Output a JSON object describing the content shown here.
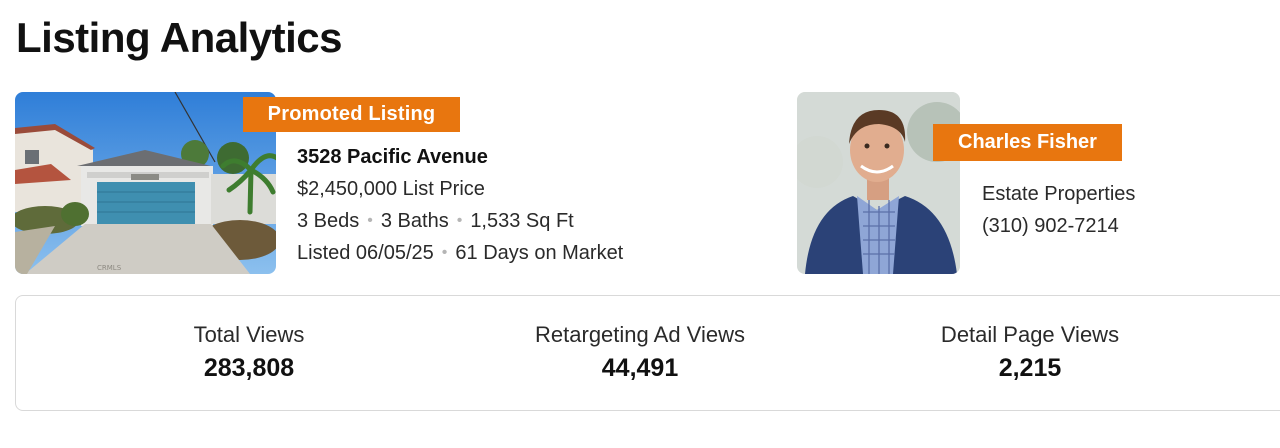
{
  "page": {
    "title": "Listing Analytics"
  },
  "listing": {
    "badge": "Promoted Listing",
    "address": "3528 Pacific Avenue",
    "price": "$2,450,000 List Price",
    "beds": "3 Beds",
    "baths": "3 Baths",
    "sqft": "1,533 Sq Ft",
    "listed": "Listed 06/05/25",
    "days_on_market": "61 Days on Market",
    "separator": "•",
    "photo_watermark": "CRMLS"
  },
  "agent": {
    "name": "Charles Fisher",
    "company": "Estate Properties",
    "phone": "(310) 902-7214"
  },
  "stats": [
    {
      "label": "Total Views",
      "value": "283,808"
    },
    {
      "label": "Retargeting Ad Views",
      "value": "44,491"
    },
    {
      "label": "Detail Page Views",
      "value": "2,215"
    }
  ],
  "colors": {
    "accent": "#e8760f",
    "garage_door": "#3f8fb0",
    "sky": "#3d86d6"
  }
}
